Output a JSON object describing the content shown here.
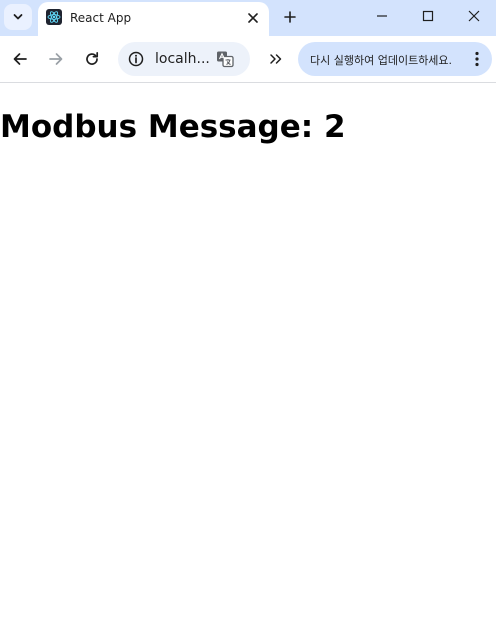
{
  "browser": {
    "tab": {
      "title": "React App"
    },
    "omnibox": {
      "url": "localh..."
    },
    "update_prompt": "다시 실행하여 업데이트하세요."
  },
  "page": {
    "heading": "Modbus Message: 2"
  },
  "colors": {
    "tabstrip": "#d3e3fd",
    "omnibox_bg": "#edf2fa",
    "update_chip_bg": "#d3e3fd",
    "react_logo": "#61dafb"
  },
  "icons": [
    "tab-search-chevron-icon",
    "react-favicon-icon",
    "close-icon",
    "plus-icon",
    "minimize-icon",
    "maximize-icon",
    "window-close-icon",
    "back-arrow-icon",
    "forward-arrow-icon",
    "reload-icon",
    "site-info-icon",
    "translate-icon",
    "chevron-double-right-icon",
    "kebab-menu-icon"
  ]
}
